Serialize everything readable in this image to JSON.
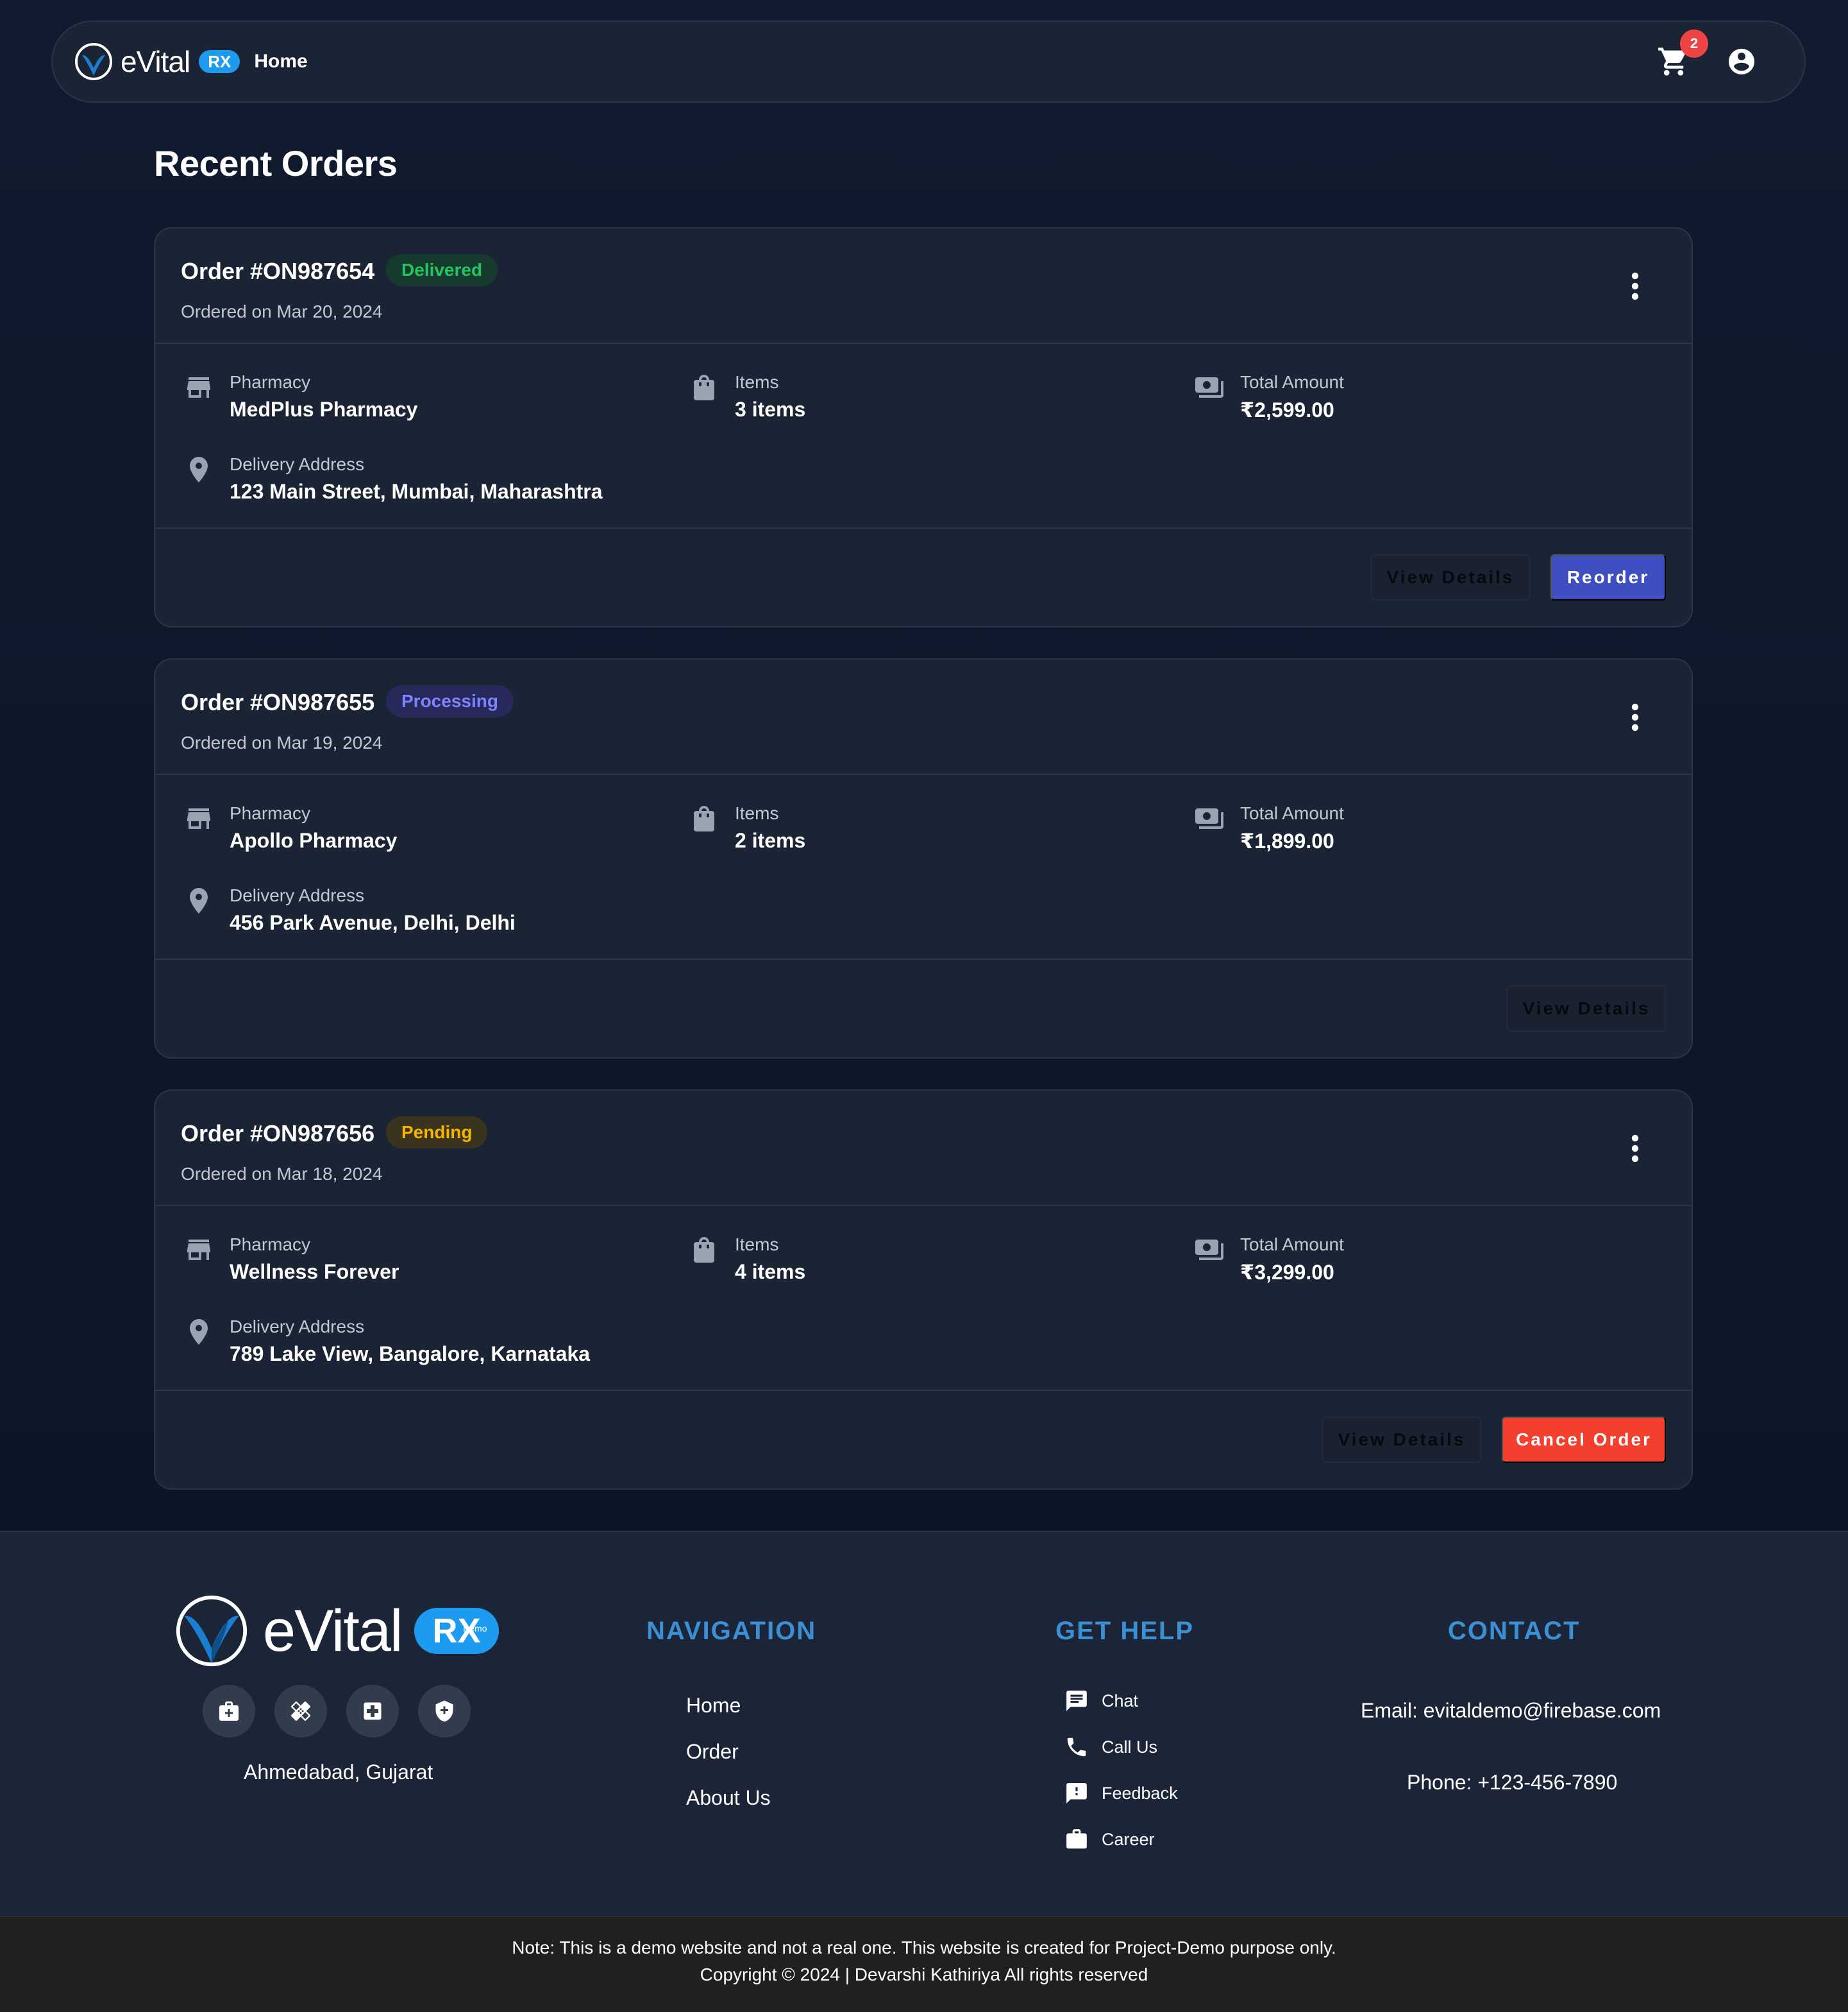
{
  "navbar": {
    "brand": "eVital",
    "brand_badge": "RX",
    "home_label": "Home",
    "cart_count": "2",
    "cart_icon": "cart-icon",
    "account_icon": "account-circle-icon"
  },
  "page_title": "Recent Orders",
  "labels": {
    "pharmacy": "Pharmacy",
    "items": "Items",
    "total": "Total Amount",
    "address": "Delivery Address",
    "view_details": "View Details"
  },
  "orders": [
    {
      "id": "Order #ON987654",
      "status": "Delivered",
      "date": "Ordered on Mar 20, 2024",
      "pharmacy": "MedPlus Pharmacy",
      "items": "3 items",
      "total": "₹2,599.00",
      "address": "123 Main Street, Mumbai, Maharashtra",
      "action": "Reorder"
    },
    {
      "id": "Order #ON987655",
      "status": "Processing",
      "date": "Ordered on Mar 19, 2024",
      "pharmacy": "Apollo Pharmacy",
      "items": "2 items",
      "total": "₹1,899.00",
      "address": "456 Park Avenue, Delhi, Delhi",
      "action": ""
    },
    {
      "id": "Order #ON987656",
      "status": "Pending",
      "date": "Ordered on Mar 18, 2024",
      "pharmacy": "Wellness Forever",
      "items": "4 items",
      "total": "₹3,299.00",
      "address": "789 Lake View, Bangalore, Karnataka",
      "action": "Cancel Order"
    }
  ],
  "footer": {
    "brand": "eVital",
    "brand_badge": "RX",
    "brand_badge_sup": "Demo",
    "city": "Ahmedabad, Gujarat",
    "social_icons": [
      "medical-bag-icon",
      "bandage-icon",
      "hospital-icon",
      "shield-icon"
    ],
    "navigation_title": "NAVIGATION",
    "navigation": [
      "Home",
      "Order",
      "About Us"
    ],
    "help_title": "GET HELP",
    "help": [
      {
        "label": "Chat",
        "icon": "chat-icon"
      },
      {
        "label": "Call Us",
        "icon": "phone-icon"
      },
      {
        "label": "Feedback",
        "icon": "feedback-icon"
      },
      {
        "label": "Career",
        "icon": "briefcase-icon"
      }
    ],
    "contact_title": "CONTACT",
    "email": "Email: evitaldemo@firebase.com",
    "phone": "Phone: +123-456-7890",
    "note": "Note: This is a demo website and not a real one. This website is created for Project-Demo purpose only.",
    "copyright": "Copyright © 2024 | Devarshi Kathiriya All rights reserved"
  },
  "colors": {
    "background": "#0f172a",
    "card": "#1b2435",
    "primary": "#3f4ec0",
    "danger": "#f43f2e",
    "delivered": "#22c55e",
    "processing": "#7c83ff",
    "pending": "#f5b400",
    "footer_heading": "#3b8fd3"
  }
}
